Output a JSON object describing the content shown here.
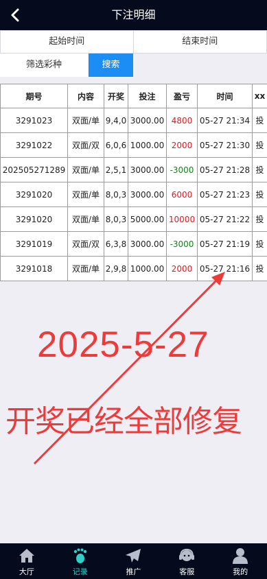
{
  "header": {
    "title": "下注明细"
  },
  "filters": {
    "start_time": "起始时间",
    "end_time": "结束时间",
    "lottery": "筛选彩种",
    "search": "搜索"
  },
  "table": {
    "columns": [
      "期号",
      "内容",
      "开奖",
      "投注",
      "盈亏",
      "时间",
      "xx"
    ],
    "rows": [
      {
        "issue": "3291023",
        "content": "双面/单",
        "draw": "9,4,0",
        "bet": "3000.00",
        "profit": "4800",
        "time": "05-27 21:34",
        "action": "投"
      },
      {
        "issue": "3291022",
        "content": "双面/双",
        "draw": "6,0,6",
        "bet": "1000.00",
        "profit": "2000",
        "time": "05-27 21:30",
        "action": "投"
      },
      {
        "issue": "202505271289",
        "content": "双面/单",
        "draw": "2,5,1",
        "bet": "3000.00",
        "profit": "-3000",
        "time": "05-27 21:28",
        "action": "投"
      },
      {
        "issue": "3291020",
        "content": "双面/单",
        "draw": "8,0,3",
        "bet": "3000.00",
        "profit": "6000",
        "time": "05-27 21:23",
        "action": "投"
      },
      {
        "issue": "3291020",
        "content": "双面/单",
        "draw": "8,0,3",
        "bet": "5000.00",
        "profit": "10000",
        "time": "05-27 21:22",
        "action": "投"
      },
      {
        "issue": "3291019",
        "content": "双面/双",
        "draw": "6,3,8",
        "bet": "3000.00",
        "profit": "-3000",
        "time": "05-27 21:19",
        "action": "投"
      },
      {
        "issue": "3291018",
        "content": "双面/单",
        "draw": "2,9,8",
        "bet": "1000.00",
        "profit": "2000",
        "time": "05-27 21:16",
        "action": "投"
      }
    ]
  },
  "overlay": {
    "date": "2025-5-27",
    "message": "开奖已经全部修复"
  },
  "tabbar": {
    "items": [
      {
        "label": "大厅",
        "icon": "home-icon"
      },
      {
        "label": "记录",
        "icon": "footprint-icon",
        "active": true
      },
      {
        "label": "推广",
        "icon": "paper-plane-icon"
      },
      {
        "label": "客服",
        "icon": "headset-icon"
      },
      {
        "label": "我的",
        "icon": "user-icon"
      }
    ]
  },
  "colors": {
    "header_bg": "#050a1c",
    "search_button": "#1b8df5",
    "profit_positive": "#e8141c",
    "profit_negative": "#0a8a10",
    "overlay_text": "#ef3a3a",
    "tab_active": "#2fd0c8"
  }
}
